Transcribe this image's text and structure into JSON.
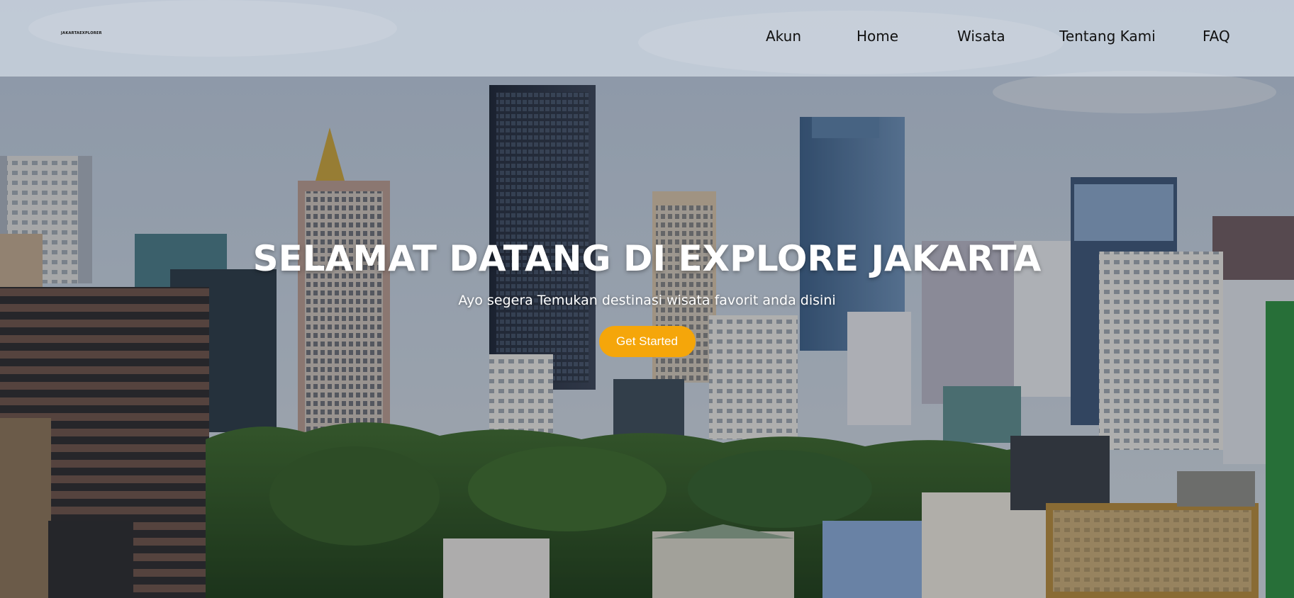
{
  "brand": {
    "logo_text": "JAKARTAEXPLORER"
  },
  "nav": {
    "items": [
      {
        "label": "Akun"
      },
      {
        "label": "Home"
      },
      {
        "label": "Wisata"
      },
      {
        "label": "Tentang Kami"
      },
      {
        "label": "FAQ"
      }
    ]
  },
  "hero": {
    "title": "SELAMAT DATANG DI EXPLORE JAKARTA",
    "subtitle": "Ayo segera Temukan destinasi wisata favorit anda disini",
    "cta_label": "Get Started"
  },
  "colors": {
    "accent": "#f5a60a",
    "text_light": "#ffffff",
    "nav_text": "#111111"
  },
  "background": {
    "description_icon": "city-skyline-photo"
  }
}
